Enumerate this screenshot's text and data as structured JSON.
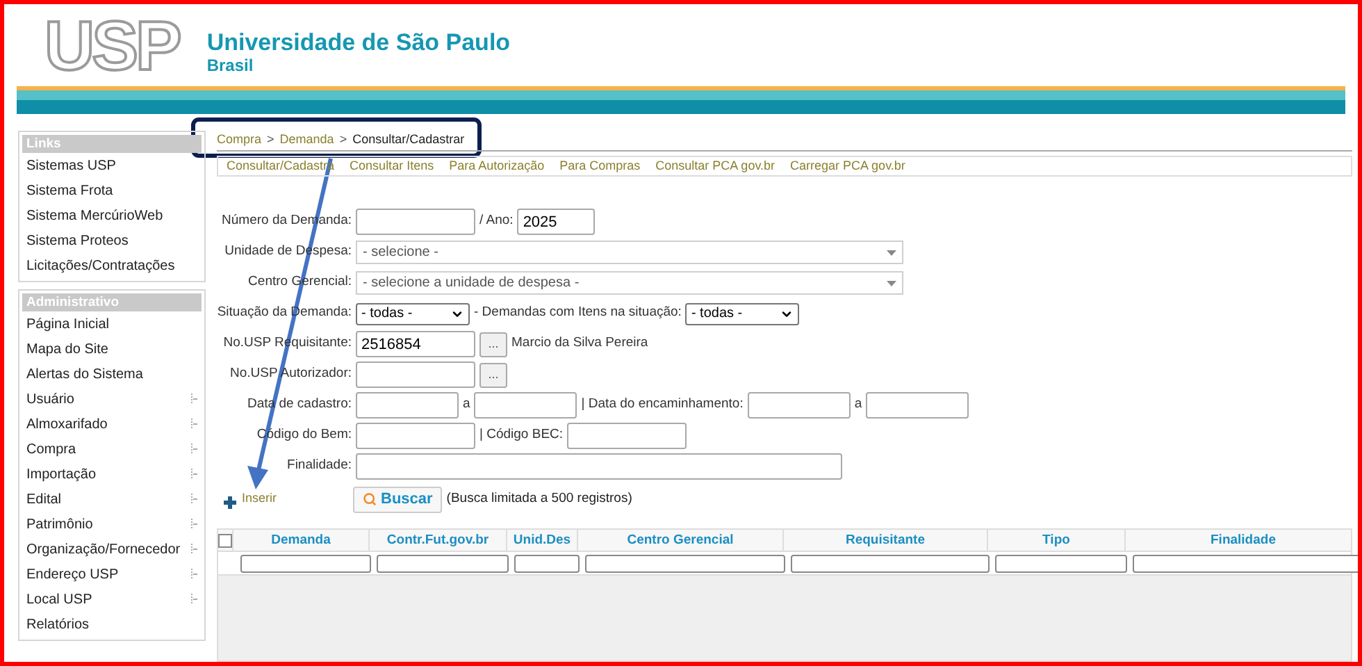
{
  "header": {
    "logo": "USP",
    "title": "Universidade de São Paulo",
    "subtitle": "Brasil"
  },
  "sidebar": [
    {
      "title": "Links",
      "items": [
        {
          "label": "Sistemas USP",
          "submenu": false
        },
        {
          "label": "Sistema Frota",
          "submenu": false
        },
        {
          "label": "Sistema MercúrioWeb",
          "submenu": false
        },
        {
          "label": "Sistema Proteos",
          "submenu": false
        },
        {
          "label": "Licitações/Contratações",
          "submenu": false
        }
      ]
    },
    {
      "title": "Administrativo",
      "items": [
        {
          "label": "Página Inicial",
          "submenu": false
        },
        {
          "label": "Mapa do Site",
          "submenu": false
        },
        {
          "label": "Alertas do Sistema",
          "submenu": false
        },
        {
          "label": "Usuário",
          "submenu": true
        },
        {
          "label": "Almoxarifado",
          "submenu": true
        },
        {
          "label": "Compra",
          "submenu": true
        },
        {
          "label": "Importação",
          "submenu": true
        },
        {
          "label": "Edital",
          "submenu": true
        },
        {
          "label": "Patrimônio",
          "submenu": true
        },
        {
          "label": "Organização/Fornecedor",
          "submenu": true
        },
        {
          "label": "Endereço USP",
          "submenu": true
        },
        {
          "label": "Local USP",
          "submenu": true
        },
        {
          "label": "Relatórios",
          "submenu": false
        }
      ]
    }
  ],
  "breadcrumb": [
    {
      "label": "Compra",
      "kind": "link"
    },
    {
      "label": ">",
      "kind": "separator"
    },
    {
      "label": "Demanda",
      "kind": "link"
    },
    {
      "label": ">",
      "kind": "separator"
    },
    {
      "label": "Consultar/Cadastrar",
      "kind": "current"
    }
  ],
  "tabs": [
    "Consultar/Cadastra",
    "Consultar Itens",
    "Para Autorização",
    "Para Compras",
    "Consultar PCA gov.br",
    "Carregar PCA gov.br"
  ],
  "form": {
    "rows": [
      {
        "label": "Número da Demanda:",
        "fields": [
          {
            "kind": "input"
          },
          {
            "kind": "text",
            "text": "/ Ano:"
          },
          {
            "kind": "input",
            "value": "2025"
          }
        ]
      },
      {
        "label": "Unidade de Despesa:",
        "fields": [
          {
            "kind": "combo",
            "value": "- selecione -"
          }
        ]
      },
      {
        "label": "Centro Gerencial:",
        "fields": [
          {
            "kind": "combo",
            "value": "- selecione a unidade de despesa -"
          }
        ]
      },
      {
        "label": "Situação da Demanda:",
        "fields": [
          {
            "kind": "select",
            "value": "- todas -"
          },
          {
            "kind": "text",
            "text": "- Demandas com Itens na situação:"
          },
          {
            "kind": "select",
            "value": "- todas -"
          }
        ]
      },
      {
        "label": "No.USP Requisitante:",
        "fields": [
          {
            "kind": "input",
            "value": "2516854"
          },
          {
            "kind": "lookup",
            "label": "..."
          },
          {
            "kind": "note",
            "text": "Marcio da Silva Pereira"
          }
        ]
      },
      {
        "label": "No.USP Autorizador:",
        "fields": [
          {
            "kind": "input"
          },
          {
            "kind": "lookup",
            "label": "..."
          }
        ]
      },
      {
        "label": "Data de cadastro:",
        "fields": [
          {
            "kind": "input"
          },
          {
            "kind": "text",
            "text": "a"
          },
          {
            "kind": "input"
          },
          {
            "kind": "text",
            "text": "| Data do encaminhamento:"
          },
          {
            "kind": "input"
          },
          {
            "kind": "text",
            "text": "a"
          },
          {
            "kind": "input"
          }
        ]
      },
      {
        "label": "Código do Bem:",
        "fields": [
          {
            "kind": "input"
          },
          {
            "kind": "text",
            "text": "| Código BEC:"
          },
          {
            "kind": "input"
          }
        ]
      },
      {
        "label": "Finalidade:",
        "fields": [
          {
            "kind": "input"
          }
        ]
      }
    ]
  },
  "actions": {
    "insert": "Inserir",
    "search": "Buscar",
    "note": "(Busca limitada a 500 registros)"
  },
  "table": {
    "select_all": {
      "checked": false
    },
    "columns": [
      "Demanda",
      "Contr.Fut.gov.br",
      "Unid.Des",
      "Centro Gerencial",
      "Requisitante",
      "Tipo",
      "Finalidade"
    ]
  }
}
